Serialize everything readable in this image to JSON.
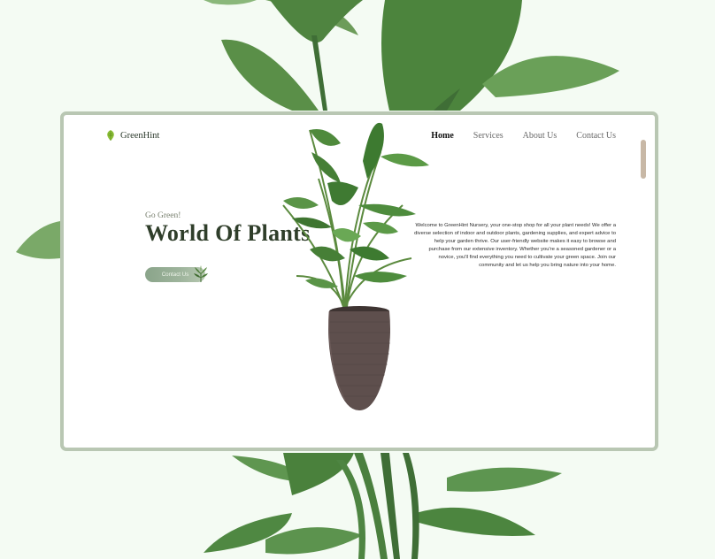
{
  "site": {
    "name": "GreenHint"
  },
  "nav": {
    "items": [
      "Home",
      "Services",
      "About Us",
      "Contact Us"
    ],
    "active": "Home"
  },
  "hero": {
    "tagline": "Go Green!",
    "title": "World Of Plants",
    "cta": "Contact Us",
    "description": "Welcome to GreenHint Nursery, your one-stop shop for all your plant needs! We offer a diverse selection of indoor and outdoor plants, gardening supplies, and expert advice to help your garden thrive. Our user-friendly website makes it easy to browse and purchase from our extensive inventory. Whether you're a seasoned gardener or a novice, you'll find everything you need to cultivate your green space. Join our community and let us help you bring nature into your home."
  },
  "icons": [
    "leaf-logo-icon",
    "hero-plant-image",
    "background-plant-image",
    "cta-plant-icon"
  ],
  "colors": {
    "page_bg": "#f4fbf3",
    "card_border": "#b9c7b3",
    "title": "#2f3e2a",
    "button": "#9fb59d",
    "pot": "#5e4f4d"
  }
}
